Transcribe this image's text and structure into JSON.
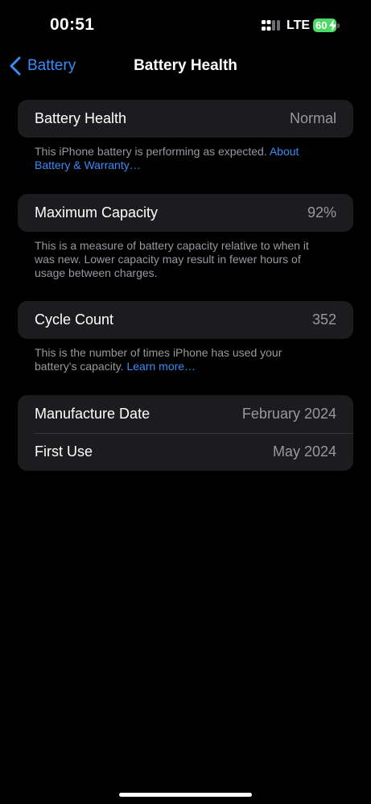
{
  "status_bar": {
    "time": "00:51",
    "carrier": "LTE",
    "battery_percent": "60",
    "signal_icon": "signal-bars-icon",
    "battery_icon": "battery-charging-icon"
  },
  "nav": {
    "back_label": "Battery",
    "title": "Battery Health",
    "back_icon": "chevron-left-icon"
  },
  "health": {
    "label": "Battery Health",
    "value": "Normal",
    "note": "This iPhone battery is performing as expected.",
    "link": "About Battery & Warranty…"
  },
  "capacity": {
    "label": "Maximum Capacity",
    "value": "92%",
    "note": "This is a measure of battery capacity relative to when it was new. Lower capacity may result in fewer hours of usage between charges."
  },
  "cycles": {
    "label": "Cycle Count",
    "value": "352",
    "note": "This is the number of times iPhone has used your battery's capacity.",
    "link": "Learn more…"
  },
  "dates": {
    "manufacture_label": "Manufacture Date",
    "manufacture_value": "February 2024",
    "first_use_label": "First Use",
    "first_use_value": "May 2024"
  },
  "colors": {
    "accent": "#3a8cf5",
    "background": "#000000",
    "cell": "#1c1c1e",
    "battery_fill": "#4cd964"
  }
}
